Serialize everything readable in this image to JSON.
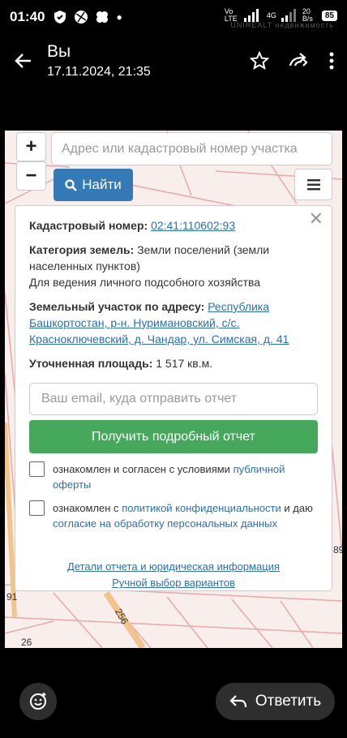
{
  "status_bar": {
    "time": "01:40",
    "network": "Vo LTE",
    "signal": "4G",
    "speed": "20 B/s",
    "battery": "85",
    "watermark": "UNIREALT недвижимость"
  },
  "app_bar": {
    "sender": "Вы",
    "date": "17.11.2024, 21:35",
    "icons": [
      "back-icon",
      "star-icon",
      "forward-icon",
      "more-icon"
    ]
  },
  "map": {
    "zoom_in": "+",
    "zoom_out": "−",
    "search_placeholder": "Адрес или кадастровый номер участка",
    "find_label": "Найти",
    "labels": [
      "91",
      "256",
      "26",
      "89"
    ]
  },
  "card": {
    "cadastral_label": "Кадастровый номер:",
    "cadastral_value": "02:41:110602:93",
    "category_label": "Категория земель:",
    "category_value": "Земли поселений (земли населенных пунктов)",
    "category_use": "Для ведения личного подсобного хозяйства",
    "address_label": "Земельный участок по адресу:",
    "address_value": "Республика Башкортостан, р-н. Нуримановский, с/с. Красноключевский, д. Чандар, ул. Симская, д. 41",
    "area_label": "Уточненная площадь:",
    "area_value": "1 517 кв.м.",
    "email_placeholder": "Ваш email, куда отправить отчет",
    "report_button": "Получить подробный отчет",
    "consent1_text": "ознакомлен и согласен с условиями",
    "consent1_link": "публичной оферты",
    "consent2_text_a": "ознакомлен с",
    "consent2_link_a": "политикой конфиденциальности",
    "consent2_text_b": "и даю",
    "consent2_link_b": "согласие на обработку персональных данных",
    "details_link": "Детали отчета и юридическая информация",
    "manual_link": "Ручной выбор вариантов"
  },
  "bottom": {
    "reply_label": "Ответить"
  }
}
